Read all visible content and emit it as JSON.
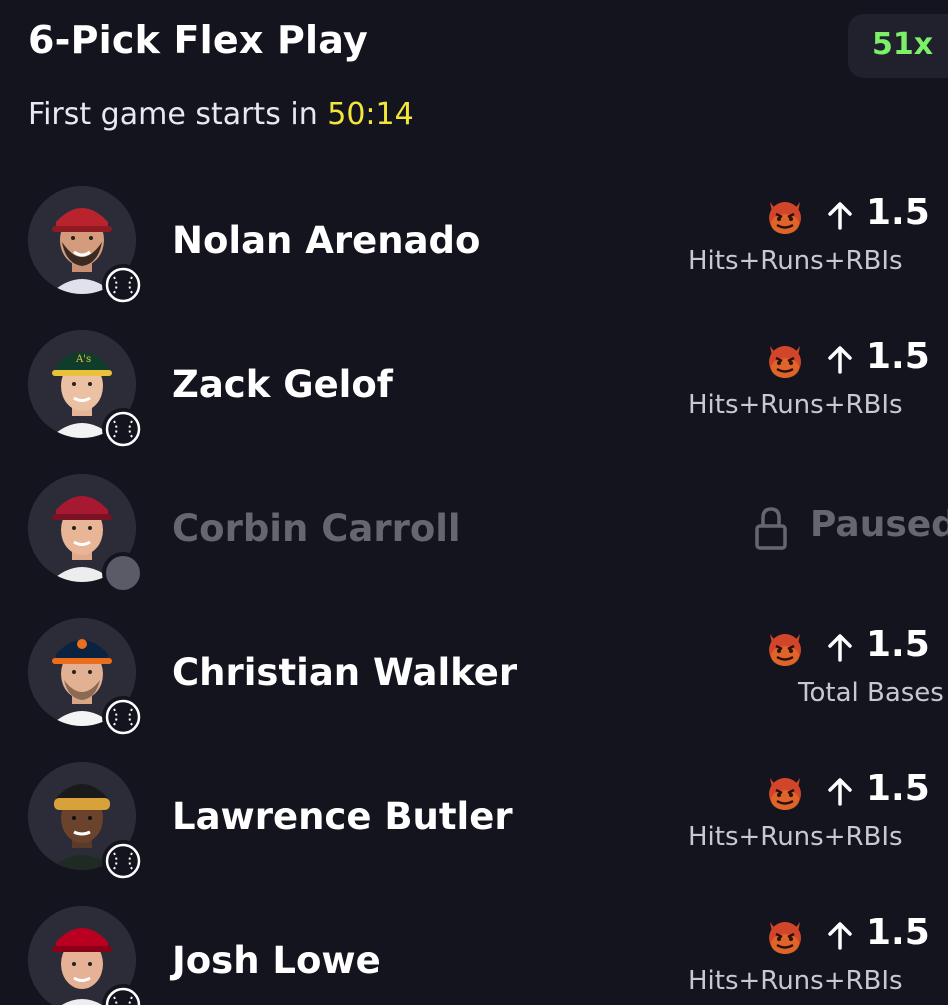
{
  "header": {
    "title": "6-Pick Flex Play",
    "multiplier": "51x",
    "countdown_prefix": "First game starts in",
    "countdown_value": "50:14"
  },
  "colors": {
    "background": "#14141f",
    "multiplier_text": "#7cf068",
    "countdown": "#f2e63a",
    "paused_text": "#66666e"
  },
  "picks": [
    {
      "name": "Nolan Arenado",
      "status": "active",
      "indicator_icon": "devil-emoji-icon",
      "direction_icon": "arrow-up-icon",
      "line": "1.5",
      "stat": "Hits+Runs+RBIs",
      "sport_icon": "baseball-icon"
    },
    {
      "name": "Zack Gelof",
      "status": "active",
      "indicator_icon": "devil-emoji-icon",
      "direction_icon": "arrow-up-icon",
      "line": "1.5",
      "stat": "Hits+Runs+RBIs",
      "sport_icon": "baseball-icon"
    },
    {
      "name": "Corbin Carroll",
      "status": "paused",
      "status_icon": "lock-icon",
      "status_label": "Paused"
    },
    {
      "name": "Christian Walker",
      "status": "active",
      "indicator_icon": "devil-emoji-icon",
      "direction_icon": "arrow-up-icon",
      "line": "1.5",
      "stat": "Total Bases",
      "sport_icon": "baseball-icon"
    },
    {
      "name": "Lawrence Butler",
      "status": "active",
      "indicator_icon": "devil-emoji-icon",
      "direction_icon": "arrow-up-icon",
      "line": "1.5",
      "stat": "Hits+Runs+RBIs",
      "sport_icon": "baseball-icon"
    },
    {
      "name": "Josh Lowe",
      "status": "active",
      "indicator_icon": "devil-emoji-icon",
      "direction_icon": "arrow-up-icon",
      "line": "1.5",
      "stat": "Hits+Runs+RBIs",
      "sport_icon": "baseball-icon"
    }
  ]
}
